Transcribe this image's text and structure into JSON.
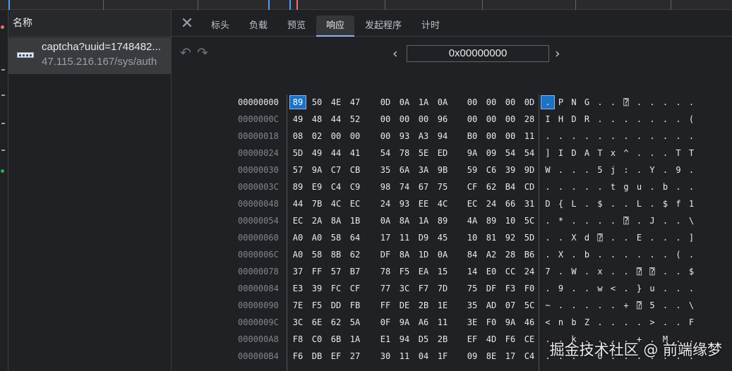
{
  "list": {
    "header": "名称",
    "request": {
      "name": "captcha?uuid=1748482...",
      "url": "47.115.216.167/sys/auth"
    }
  },
  "tabs": [
    {
      "label": "标头",
      "active": false
    },
    {
      "label": "负载",
      "active": false
    },
    {
      "label": "预览",
      "active": false
    },
    {
      "label": "响应",
      "active": true
    },
    {
      "label": "发起程序",
      "active": false
    },
    {
      "label": "计时",
      "active": false
    }
  ],
  "toolbar": {
    "address": "0x00000000",
    "undo_icon": "undo-icon",
    "redo_icon": "redo-icon"
  },
  "hex": {
    "selected_offset": "00000000",
    "rows": [
      {
        "offset": "00000000",
        "bytes": [
          "89",
          "50",
          "4E",
          "47",
          "0D",
          "0A",
          "1A",
          "0A",
          "00",
          "00",
          "00",
          "0D"
        ],
        "chars": [
          ".",
          "P",
          "N",
          "G",
          ".",
          ".",
          "⍰",
          ".",
          ".",
          ".",
          ".",
          "."
        ]
      },
      {
        "offset": "0000000C",
        "bytes": [
          "49",
          "48",
          "44",
          "52",
          "00",
          "00",
          "00",
          "96",
          "00",
          "00",
          "00",
          "28"
        ],
        "chars": [
          "I",
          "H",
          "D",
          "R",
          ".",
          ".",
          ".",
          ".",
          ".",
          ".",
          ".",
          "("
        ]
      },
      {
        "offset": "00000018",
        "bytes": [
          "08",
          "02",
          "00",
          "00",
          "00",
          "93",
          "A3",
          "94",
          "B0",
          "00",
          "00",
          "11"
        ],
        "chars": [
          ".",
          ".",
          ".",
          ".",
          ".",
          ".",
          ".",
          ".",
          ".",
          ".",
          ".",
          "."
        ]
      },
      {
        "offset": "00000024",
        "bytes": [
          "5D",
          "49",
          "44",
          "41",
          "54",
          "78",
          "5E",
          "ED",
          "9A",
          "09",
          "54",
          "54"
        ],
        "chars": [
          "]",
          "I",
          "D",
          "A",
          "T",
          "x",
          "^",
          ".",
          ".",
          ".",
          "T",
          "T"
        ]
      },
      {
        "offset": "00000030",
        "bytes": [
          "57",
          "9A",
          "C7",
          "CB",
          "35",
          "6A",
          "3A",
          "9B",
          "59",
          "C6",
          "39",
          "9D"
        ],
        "chars": [
          "W",
          ".",
          ".",
          ".",
          "5",
          "j",
          ":",
          ".",
          "Y",
          ".",
          "9",
          "."
        ]
      },
      {
        "offset": "0000003C",
        "bytes": [
          "89",
          "E9",
          "C4",
          "C9",
          "98",
          "74",
          "67",
          "75",
          "CF",
          "62",
          "B4",
          "CD"
        ],
        "chars": [
          ".",
          ".",
          ".",
          ".",
          ".",
          "t",
          "g",
          "u",
          ".",
          "b",
          ".",
          "."
        ]
      },
      {
        "offset": "00000048",
        "bytes": [
          "44",
          "7B",
          "4C",
          "EC",
          "24",
          "93",
          "EE",
          "4C",
          "EC",
          "24",
          "66",
          "31"
        ],
        "chars": [
          "D",
          "{",
          "L",
          ".",
          "$",
          ".",
          ".",
          "L",
          ".",
          "$",
          "f",
          "1"
        ]
      },
      {
        "offset": "00000054",
        "bytes": [
          "EC",
          "2A",
          "8A",
          "1B",
          "0A",
          "8A",
          "1A",
          "89",
          "4A",
          "89",
          "10",
          "5C"
        ],
        "chars": [
          ".",
          "*",
          ".",
          ".",
          ".",
          ".",
          "⍰",
          ".",
          "J",
          ".",
          ".",
          "\\"
        ]
      },
      {
        "offset": "00000060",
        "bytes": [
          "A0",
          "A0",
          "58",
          "64",
          "17",
          "11",
          "D9",
          "45",
          "10",
          "81",
          "92",
          "5D"
        ],
        "chars": [
          ".",
          ".",
          "X",
          "d",
          "⍰",
          ".",
          ".",
          "E",
          ".",
          ".",
          ".",
          "]"
        ]
      },
      {
        "offset": "0000006C",
        "bytes": [
          "A0",
          "58",
          "8B",
          "62",
          "DF",
          "8A",
          "1D",
          "0A",
          "84",
          "A2",
          "28",
          "B6"
        ],
        "chars": [
          ".",
          "X",
          ".",
          "b",
          ".",
          ".",
          ".",
          ".",
          ".",
          ".",
          "(",
          "."
        ]
      },
      {
        "offset": "00000078",
        "bytes": [
          "37",
          "FF",
          "57",
          "B7",
          "78",
          "F5",
          "EA",
          "15",
          "14",
          "E0",
          "CC",
          "24"
        ],
        "chars": [
          "7",
          ".",
          "W",
          ".",
          "x",
          ".",
          ".",
          "⍰",
          "⍰",
          ".",
          ".",
          "$"
        ]
      },
      {
        "offset": "00000084",
        "bytes": [
          "E3",
          "39",
          "FC",
          "CF",
          "77",
          "3C",
          "F7",
          "7D",
          "75",
          "DF",
          "F3",
          "F0"
        ],
        "chars": [
          ".",
          "9",
          ".",
          ".",
          "w",
          "<",
          ".",
          "}",
          "u",
          ".",
          ".",
          "."
        ]
      },
      {
        "offset": "00000090",
        "bytes": [
          "7E",
          "F5",
          "DD",
          "FB",
          "FF",
          "DE",
          "2B",
          "1E",
          "35",
          "AD",
          "07",
          "5C"
        ],
        "chars": [
          "~",
          ".",
          ".",
          ".",
          ".",
          ".",
          "+",
          "⍰",
          "5",
          ".",
          ".",
          "\\"
        ]
      },
      {
        "offset": "0000009C",
        "bytes": [
          "3C",
          "6E",
          "62",
          "5A",
          "0F",
          "9A",
          "A6",
          "11",
          "3E",
          "F0",
          "9A",
          "46"
        ],
        "chars": [
          "<",
          "n",
          "b",
          "Z",
          ".",
          ".",
          ".",
          ".",
          ">",
          ".",
          ".",
          "F"
        ]
      },
      {
        "offset": "000000A8",
        "bytes": [
          "F8",
          "C0",
          "6B",
          "1A",
          "E1",
          "94",
          "D5",
          "2B",
          "EF",
          "4D",
          "F6",
          "CE"
        ],
        "chars": [
          ".",
          ".",
          "k",
          ".",
          ".",
          ".",
          ".",
          "+",
          ".",
          "M",
          ".",
          "."
        ]
      },
      {
        "offset": "000000B4",
        "bytes": [
          "F6",
          "DB",
          "EF",
          "27",
          "30",
          "11",
          "04",
          "1F",
          "09",
          "8E",
          "17",
          "C4"
        ],
        "chars": [
          ".",
          ".",
          ".",
          "'",
          "0",
          ".",
          ".",
          ".",
          ".",
          ".",
          ".",
          "."
        ]
      }
    ]
  },
  "watermark": "掘金技术社区 @ 前端缘梦",
  "colors": {
    "accent": "#1a73c4",
    "tab_underline": "#8ab4f8",
    "background": "#202124"
  }
}
